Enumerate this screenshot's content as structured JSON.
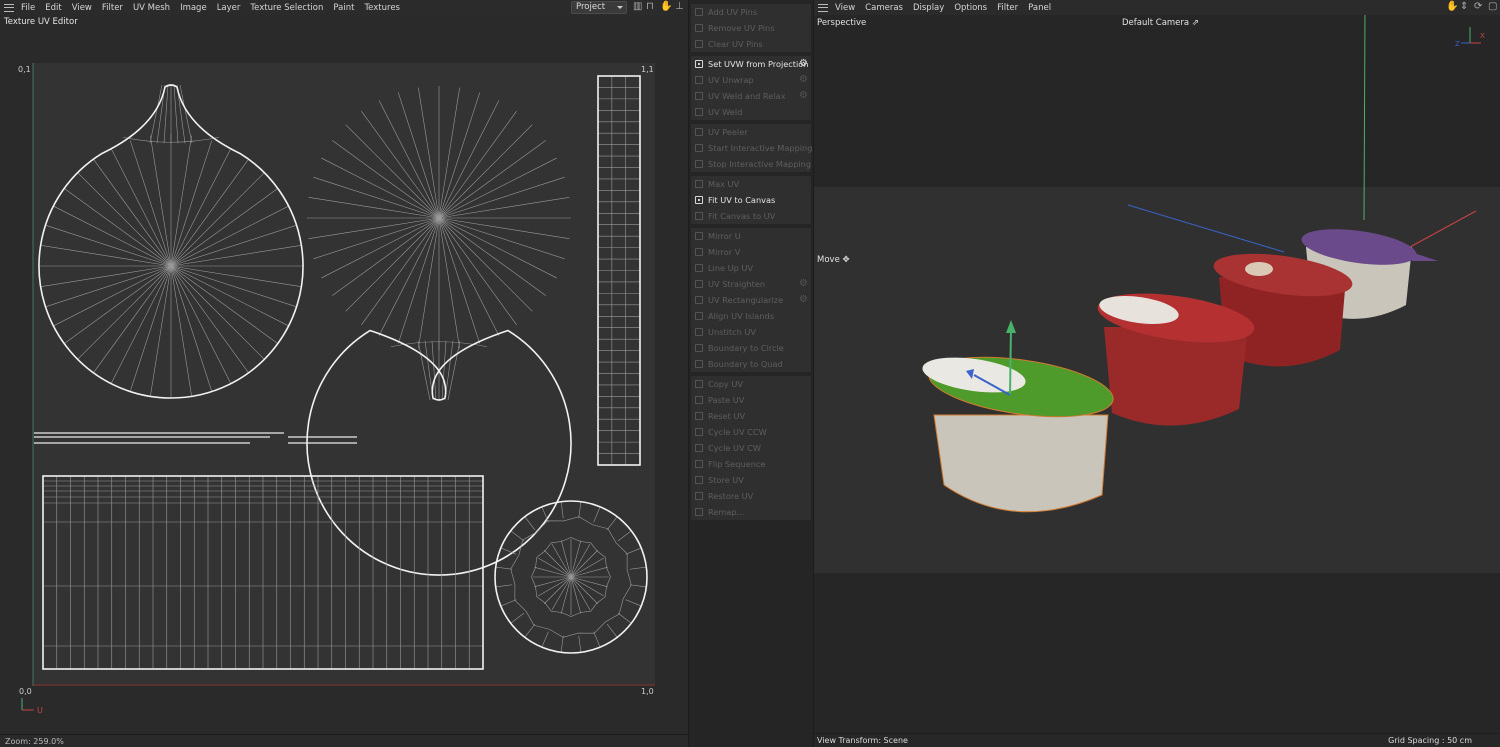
{
  "uv_editor": {
    "menu": [
      "File",
      "Edit",
      "View",
      "Filter",
      "UV Mesh",
      "Image",
      "Layer",
      "Texture Selection",
      "Paint",
      "Textures"
    ],
    "mode_select": "Project",
    "title": "Texture UV Editor",
    "corner_labels": {
      "top_left": "0,1",
      "top_right": "1,1",
      "bottom_left": "0,0",
      "bottom_right": "1,0"
    },
    "axis_u_label": "U",
    "zoom": "Zoom: 259.0%"
  },
  "commands": {
    "groups": [
      [
        {
          "label": "Add UV Pins",
          "enabled": false,
          "icon": "pin-add-icon"
        },
        {
          "label": "Remove UV Pins",
          "enabled": false,
          "icon": "pin-remove-icon"
        },
        {
          "label": "Clear UV Pins",
          "enabled": false,
          "icon": "pin-clear-icon"
        }
      ],
      [
        {
          "label": "Set UVW from Projection",
          "enabled": true,
          "icon": "projection-icon",
          "gear": true
        },
        {
          "label": "UV Unwrap",
          "enabled": false,
          "icon": "unwrap-icon",
          "gear": true
        },
        {
          "label": "UV Weld and Relax",
          "enabled": false,
          "icon": "weld-relax-icon",
          "gear": true
        },
        {
          "label": "UV Weld",
          "enabled": false,
          "icon": "weld-icon"
        }
      ],
      [
        {
          "label": "UV Peeler",
          "enabled": false,
          "icon": "peeler-icon"
        },
        {
          "label": "Start Interactive Mapping",
          "enabled": false,
          "icon": "play-icon"
        },
        {
          "label": "Stop Interactive Mapping",
          "enabled": false,
          "icon": "stop-icon"
        }
      ],
      [
        {
          "label": "Max UV",
          "enabled": false,
          "icon": "max-uv-icon"
        },
        {
          "label": "Fit UV to Canvas",
          "enabled": true,
          "icon": "fit-canvas-icon"
        },
        {
          "label": "Fit Canvas to UV",
          "enabled": false,
          "icon": "fit-uv-icon"
        }
      ],
      [
        {
          "label": "Mirror U",
          "enabled": false,
          "icon": "mirror-u-icon"
        },
        {
          "label": "Mirror V",
          "enabled": false,
          "icon": "mirror-v-icon"
        },
        {
          "label": "Line Up UV",
          "enabled": false,
          "icon": "line-up-icon"
        },
        {
          "label": "UV Straighten",
          "enabled": false,
          "icon": "straighten-icon",
          "gear": true
        },
        {
          "label": "UV Rectangularize",
          "enabled": false,
          "icon": "rectangularize-icon",
          "gear": true
        },
        {
          "label": "Align UV Islands",
          "enabled": false,
          "icon": "align-icon"
        },
        {
          "label": "Unstitch UV",
          "enabled": false,
          "icon": "unstitch-icon"
        },
        {
          "label": "Boundary to Circle",
          "enabled": false,
          "icon": "circle-icon"
        },
        {
          "label": "Boundary to Quad",
          "enabled": false,
          "icon": "quad-icon"
        }
      ],
      [
        {
          "label": "Copy UV",
          "enabled": false,
          "icon": "copy-icon"
        },
        {
          "label": "Paste UV",
          "enabled": false,
          "icon": "paste-icon"
        },
        {
          "label": "Reset UV",
          "enabled": false,
          "icon": "reset-icon"
        },
        {
          "label": "Cycle UV CCW",
          "enabled": false,
          "icon": "cycle-ccw-icon"
        },
        {
          "label": "Cycle UV CW",
          "enabled": false,
          "icon": "cycle-cw-icon"
        },
        {
          "label": "Flip Sequence",
          "enabled": false,
          "icon": "flip-icon"
        },
        {
          "label": "Store UV",
          "enabled": false,
          "icon": "store-icon"
        },
        {
          "label": "Restore UV",
          "enabled": false,
          "icon": "restore-icon"
        },
        {
          "label": "Remap...",
          "enabled": false,
          "icon": "remap-icon"
        }
      ]
    ]
  },
  "viewport": {
    "menu": [
      "View",
      "Cameras",
      "Display",
      "Options",
      "Filter",
      "Panel"
    ],
    "name": "Perspective",
    "camera": "Default Camera",
    "tool": "Move",
    "view_transform": "View Transform: Scene",
    "grid_spacing": "Grid Spacing : 50 cm",
    "colors": {
      "green_lid": "#4e9a2a",
      "red_cup": "#9a2a2a",
      "purple_lid": "#6a4a8a",
      "cup_white": "#c9c5bb"
    }
  }
}
